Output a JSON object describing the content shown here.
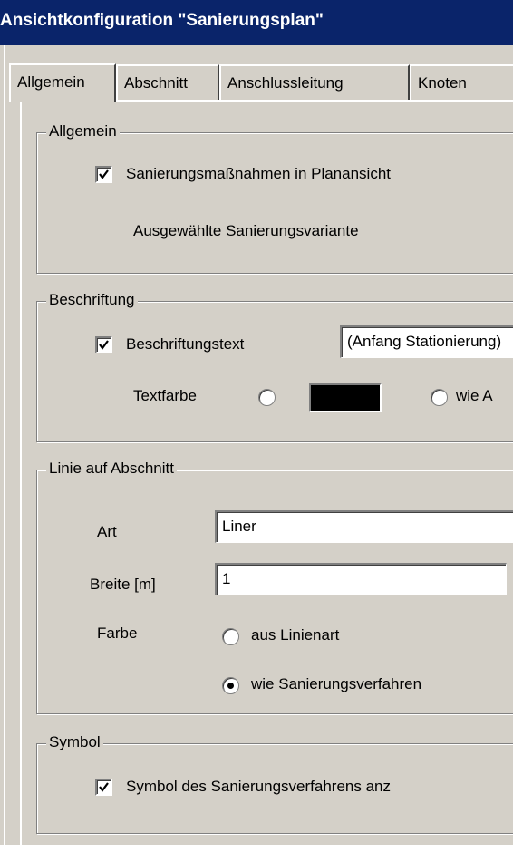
{
  "window": {
    "title": "Ansichtkonfiguration \"Sanierungsplan\""
  },
  "tabs": [
    "Allgemein",
    "Abschnitt",
    "Anschlussleitung",
    "Knoten"
  ],
  "groups": {
    "allgemein": {
      "legend": "Allgemein",
      "checkbox_label": "Sanierungsmaßnahmen in Planansicht",
      "checkbox_checked": true,
      "variant_label": "Ausgewählte Sanierungsvariante"
    },
    "beschriftung": {
      "legend": "Beschriftung",
      "checkbox_label": "Beschriftungstext",
      "checkbox_checked": true,
      "text_value": "(Anfang Stationierung)",
      "textfarbe_label": "Textfarbe",
      "swatch_color": "#000000",
      "wie_label": "wie A"
    },
    "linie": {
      "legend": "Linie auf Abschnitt",
      "art_label": "Art",
      "art_value": "Liner",
      "breite_label": "Breite [m]",
      "breite_value": "1",
      "farbe_label": "Farbe",
      "option1": "aus Linienart",
      "option2": "wie Sanierungsverfahren",
      "selected": "wie Sanierungsverfahren"
    },
    "symbol": {
      "legend": "Symbol",
      "checkbox_label": "Symbol des Sanierungsverfahrens anz",
      "checkbox_checked": true
    }
  }
}
